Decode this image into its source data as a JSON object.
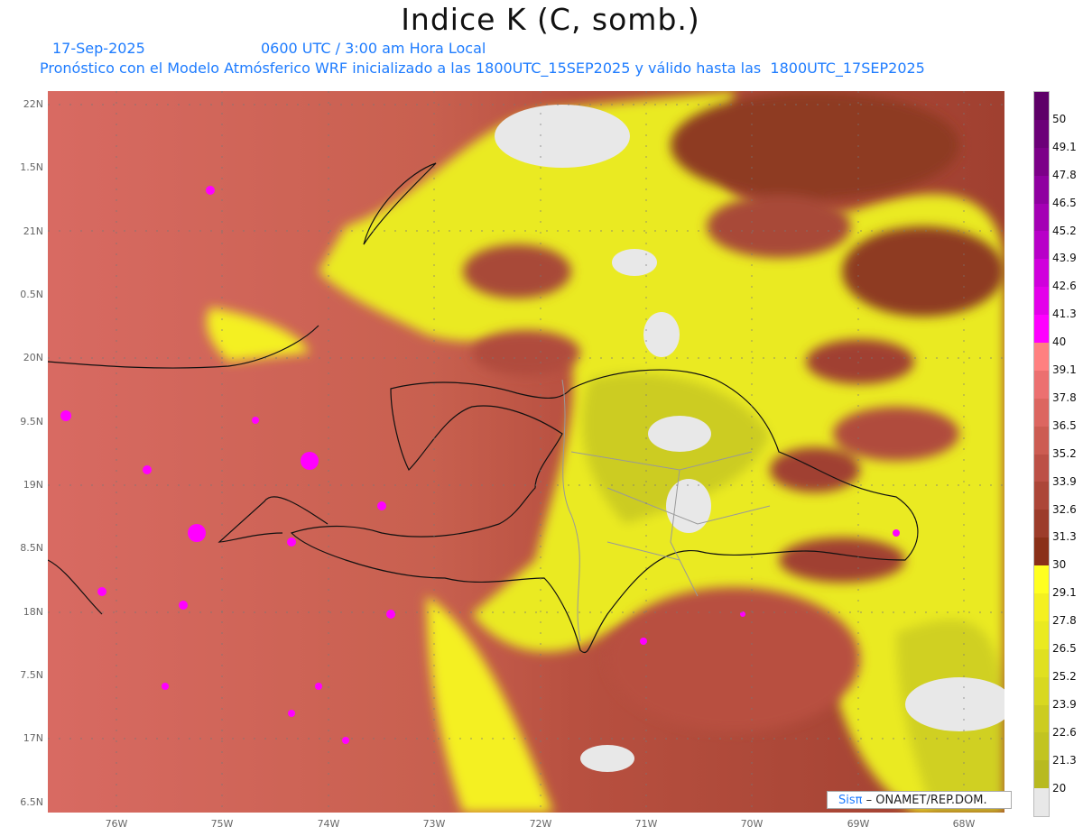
{
  "header": {
    "title": "Indice K (C, somb.)",
    "date": "17-Sep-2025",
    "time": "0600 UTC / 3:00 am Hora Local",
    "description": "Pronóstico con el Modelo Atmósferico WRF inicializado a las 1800UTC_15SEP2025 y válido hasta las  1800UTC_17SEP2025"
  },
  "map": {
    "lat_labels": [
      "22N",
      "1.5N",
      "21N",
      "0.5N",
      "20N",
      "9.5N",
      "19N",
      "8.5N",
      "18N",
      "7.5N",
      "17N",
      "6.5N"
    ],
    "lon_labels": [
      "76W",
      "75W",
      "74W",
      "73W",
      "72W",
      "71W",
      "70W",
      "69W",
      "68W"
    ]
  },
  "colorbar": {
    "labels": [
      "50",
      "49.1",
      "47.8",
      "46.5",
      "45.2",
      "43.9",
      "42.6",
      "41.3",
      "40",
      "39.1",
      "37.8",
      "36.5",
      "35.2",
      "33.9",
      "32.6",
      "31.3",
      "30",
      "29.1",
      "27.8",
      "26.5",
      "25.2",
      "23.9",
      "22.6",
      "21.3",
      "20"
    ],
    "colors": [
      "#5e0068",
      "#6c0078",
      "#7c0088",
      "#8f00a0",
      "#a400b4",
      "#b800c8",
      "#d000dc",
      "#e400ea",
      "#ff00ff",
      "#ff8080",
      "#ec7070",
      "#dc6660",
      "#cc5c52",
      "#bc5046",
      "#ac4638",
      "#9c3c2a",
      "#8a3018",
      "#ffff20",
      "#f4f020",
      "#eaea20",
      "#e0e020",
      "#d8d820",
      "#cccc20",
      "#c2c420",
      "#b8ba20",
      "#e8e8e8"
    ]
  },
  "credit": {
    "brand_sis": "Sis",
    "brand_pi": "π",
    "text": " –  ONAMET/REP.DOM."
  }
}
